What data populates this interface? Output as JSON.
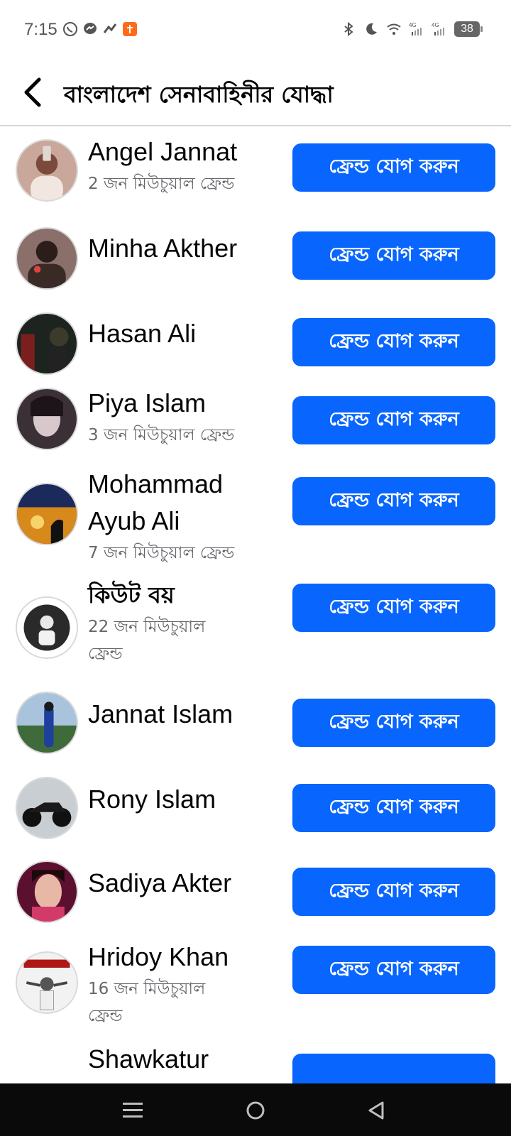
{
  "status": {
    "time": "7:15",
    "battery": "38"
  },
  "header": {
    "title": "বাংলাদেশ সেনাবাহিনীর যোদ্ধা"
  },
  "button_label": "ফ্রেন্ড যোগ করুন",
  "people": [
    {
      "name": "Angel Jannat",
      "mutual": "2 জন মিউচুয়াল ফ্রেন্ড"
    },
    {
      "name": "Minha Akther",
      "mutual": ""
    },
    {
      "name": "Hasan Ali",
      "mutual": ""
    },
    {
      "name": "Piya Islam",
      "mutual": "3 জন মিউচুয়াল ফ্রেন্ড"
    },
    {
      "name_line1": "Mohammad",
      "name_line2": "Ayub Ali",
      "mutual": "7 জন মিউচুয়াল ফ্রেন্ড"
    },
    {
      "name": "কিউট বয়",
      "mutual_line1": "22 জন মিউচুয়াল",
      "mutual_line2": "ফ্রেন্ড"
    },
    {
      "name": "Jannat Islam",
      "mutual": ""
    },
    {
      "name": "Rony Islam",
      "mutual": ""
    },
    {
      "name": "Sadiya Akter",
      "mutual": ""
    },
    {
      "name": "Hridoy Khan",
      "mutual_line1": "16 জন মিউচুয়াল",
      "mutual_line2": "ফ্রেন্ড"
    },
    {
      "name": "Shawkatur",
      "mutual": ""
    }
  ],
  "colors": {
    "accent": "#0866ff",
    "secondary_text": "#65676b"
  }
}
